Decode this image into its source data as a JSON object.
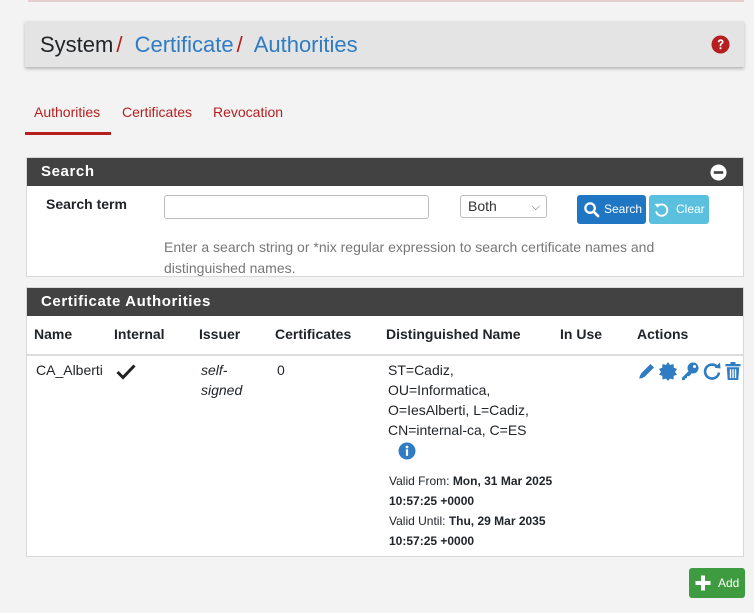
{
  "breadcrumb": {
    "system": "System",
    "certificate": "Certificate",
    "authorities": "Authorities",
    "separator": "/"
  },
  "tabs": [
    {
      "label": "Authorities",
      "active": true
    },
    {
      "label": "Certificates",
      "active": false
    },
    {
      "label": "Revocation",
      "active": false
    }
  ],
  "search": {
    "panel_title": "Search",
    "term_label": "Search term",
    "input_value": "",
    "select_value": "Both",
    "search_button": "Search",
    "clear_button": "Clear",
    "help_text": "Enter a search string or *nix regular expression to search certificate names and distinguished names."
  },
  "ca_table": {
    "panel_title": "Certificate Authorities",
    "columns": [
      "Name",
      "Internal",
      "Issuer",
      "Certificates",
      "Distinguished Name",
      "In Use",
      "Actions"
    ],
    "rows": [
      {
        "name": "CA_Alberti",
        "internal": true,
        "issuer_line1": "self-",
        "issuer_line2": "signed",
        "certificates": "0",
        "dn_lines": [
          "ST=Cadiz,",
          "OU=Informatica,",
          "O=IesAlberti, L=Cadiz,",
          "CN=internal-ca, C=ES"
        ],
        "valid_from_label": "Valid From:",
        "valid_from_date": "Mon, 31 Mar 2025",
        "valid_from_time": "10:57:25 +0000",
        "valid_until_label": "Valid Until:",
        "valid_until_date": "Thu, 29 Mar 2035",
        "valid_until_time": "10:57:25 +0000",
        "in_use": "",
        "actions": [
          "edit-icon",
          "certificate-icon",
          "key-icon",
          "renew-icon",
          "trash-icon"
        ]
      }
    ]
  },
  "add_button": "Add",
  "colors": {
    "accent_red": "#b51f1f",
    "link_blue": "#2f7cc3",
    "panel_header": "#424242",
    "search_button": "#1f76c3",
    "clear_button": "#5bc0de",
    "add_button": "#3f9b3f"
  }
}
